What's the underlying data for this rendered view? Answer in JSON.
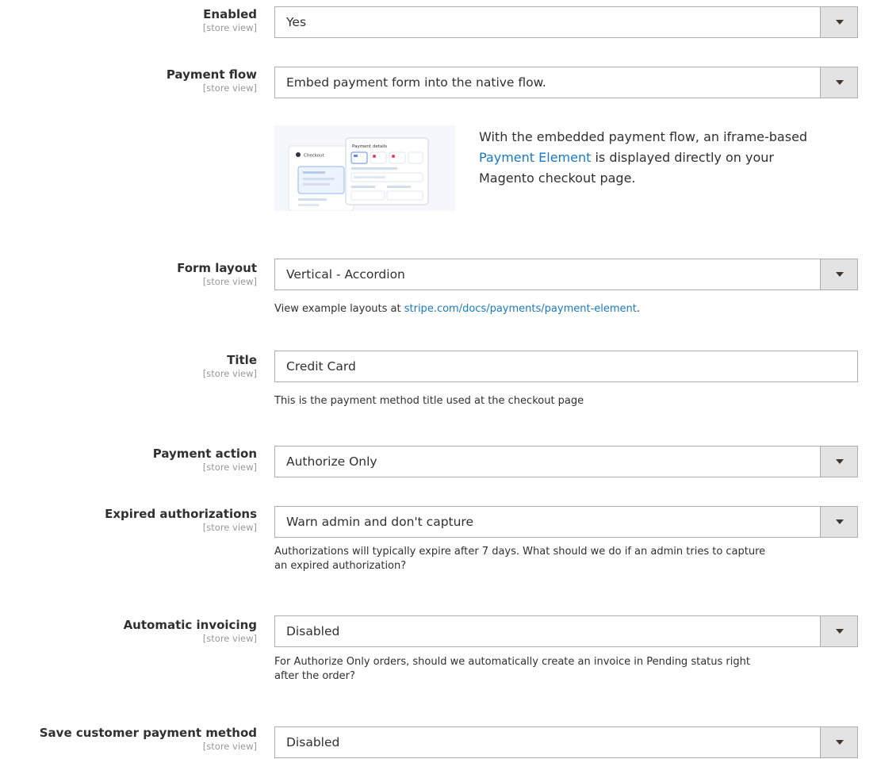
{
  "fields": {
    "enabled": {
      "label": "Enabled",
      "scope": "[store view]",
      "value": "Yes"
    },
    "payment_flow": {
      "label": "Payment flow",
      "scope": "[store view]",
      "value": "Embed payment form into the native flow."
    },
    "form_layout": {
      "label": "Form layout",
      "scope": "[store view]",
      "value": "Vertical - Accordion",
      "note_prefix": "View example layouts at ",
      "note_link": "stripe.com/docs/payments/payment-element",
      "note_suffix": "."
    },
    "title": {
      "label": "Title",
      "scope": "[store view]",
      "value": "Credit Card",
      "note": "This is the payment method title used at the checkout page"
    },
    "payment_action": {
      "label": "Payment action",
      "scope": "[store view]",
      "value": "Authorize Only"
    },
    "expired_authorizations": {
      "label": "Expired authorizations",
      "scope": "[store view]",
      "value": "Warn admin and don't capture",
      "note_line1": "Authorizations will typically expire after 7 days. What should we do if an admin tries to capture",
      "note_line2": "an expired authorization?"
    },
    "automatic_invoicing": {
      "label": "Automatic invoicing",
      "scope": "[store view]",
      "value": "Disabled",
      "note_line1": "For Authorize Only orders, should we automatically create an invoice in Pending status right",
      "note_line2": "after the order?"
    },
    "save_customer_payment_method": {
      "label": "Save customer payment method",
      "scope": "[store view]",
      "value": "Disabled"
    }
  },
  "embedded_flow": {
    "text_line1": "With the embedded payment flow, an iframe-based",
    "link": "Payment Element",
    "text_line2_suffix": " is displayed directly on your",
    "text_line3": "Magento checkout page."
  },
  "preview_mock": {
    "checkout_label": "Checkout",
    "payment_details_label": "Payment details"
  },
  "colors": {
    "link": "#1979c3",
    "text": "#303030",
    "scope": "#999999",
    "border": "#adadad",
    "arrow_bg": "#e3e3e3"
  }
}
